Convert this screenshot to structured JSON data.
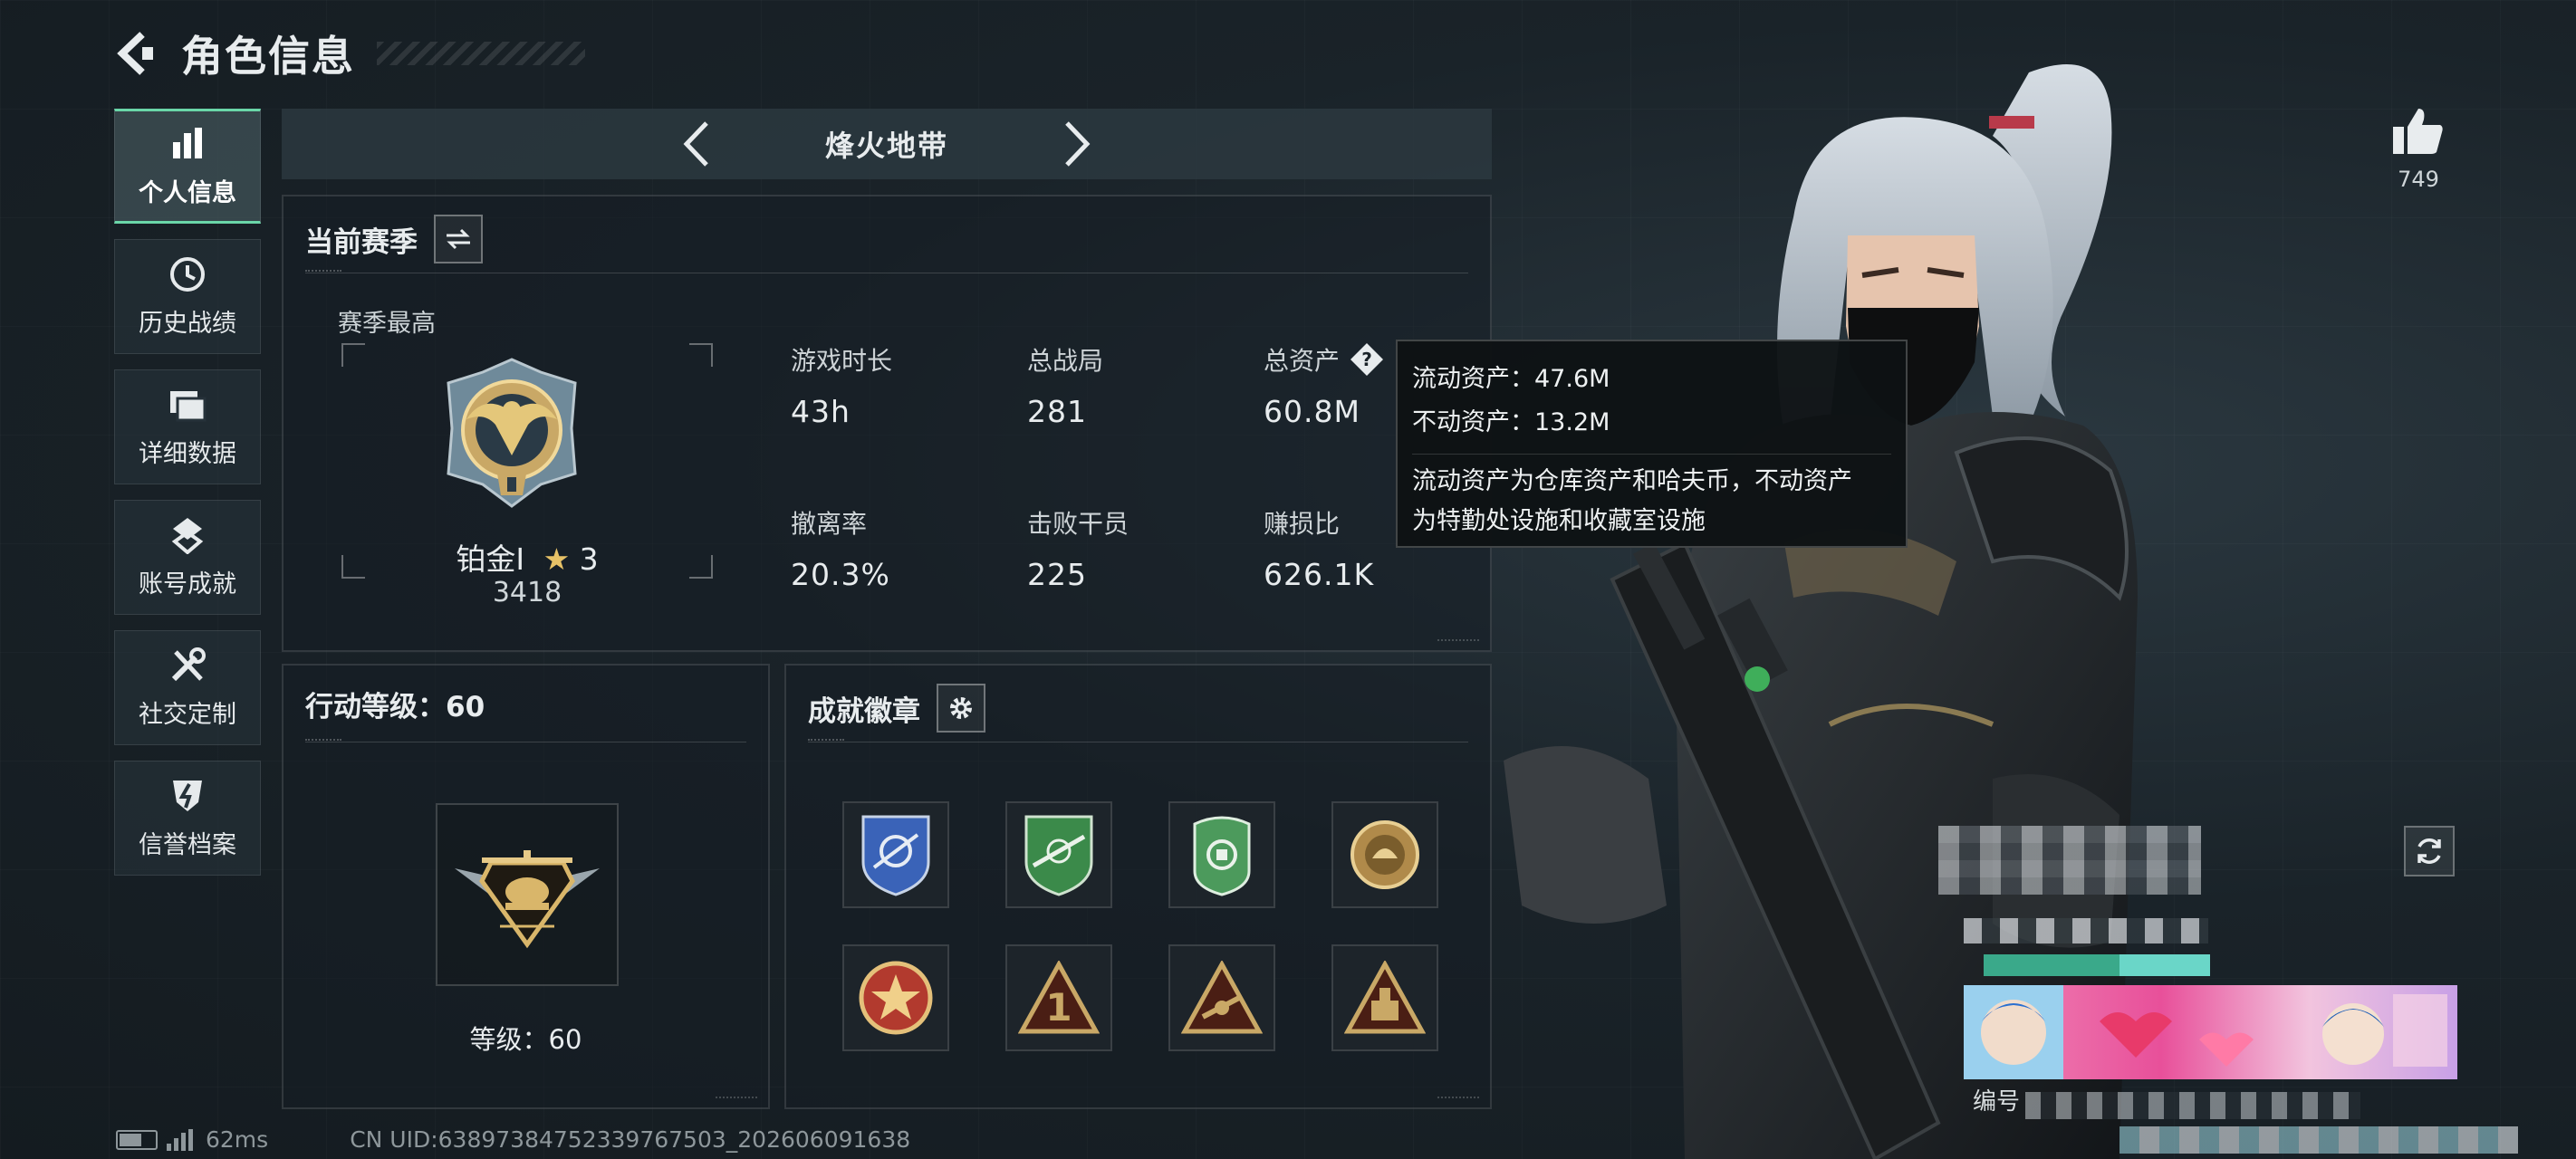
{
  "header": {
    "title": "角色信息"
  },
  "sidebar": {
    "items": [
      {
        "label": "个人信息",
        "icon": "bar-chart-icon",
        "active": true
      },
      {
        "label": "历史战绩",
        "icon": "history-icon"
      },
      {
        "label": "详细数据",
        "icon": "folder-icon"
      },
      {
        "label": "账号成就",
        "icon": "medal-icon"
      },
      {
        "label": "社交定制",
        "icon": "tools-icon"
      },
      {
        "label": "信誉档案",
        "icon": "shield-lightning-icon"
      }
    ]
  },
  "mode": {
    "name": "烽火地带"
  },
  "season": {
    "title": "当前赛季",
    "best_label": "赛季最高",
    "rank_name": "铂金Ⅰ",
    "rank_stars": "3",
    "rank_score": "3418",
    "stats": [
      {
        "label": "游戏时长",
        "value": "43h"
      },
      {
        "label": "总战局",
        "value": "281"
      },
      {
        "label": "总资产",
        "value": "60.8M",
        "has_help": true
      },
      {
        "label": "撤离率",
        "value": "20.3%"
      },
      {
        "label": "击败干员",
        "value": "225"
      },
      {
        "label": "赚损比",
        "value": "626.1K"
      }
    ]
  },
  "tooltip": {
    "liquid": "流动资产：47.6M",
    "fixed": "不动资产：13.2M",
    "desc_line1": "流动资产为仓库资产和哈夫币，不动资产",
    "desc_line2": "为特勤处设施和收藏室设施"
  },
  "level": {
    "title": "行动等级：60",
    "label": "等级：60"
  },
  "badges": {
    "title": "成就徽章",
    "items": [
      {
        "icon": "blue-shield-badge-icon",
        "color": "#3a63b8"
      },
      {
        "icon": "green-rifle-badge-icon",
        "color": "#3b8a4a"
      },
      {
        "icon": "green-crest-badge-icon",
        "color": "#4c9a5c"
      },
      {
        "icon": "bronze-coin-badge-icon",
        "color": "#b08a4a"
      },
      {
        "icon": "red-star-badge-icon",
        "color": "#b23a2e"
      },
      {
        "icon": "number-one-triangle-badge-icon",
        "color": "#c9a866"
      },
      {
        "icon": "rifle-triangle-badge-icon",
        "color": "#c9a866"
      },
      {
        "icon": "crate-triangle-badge-icon",
        "color": "#c9a866"
      }
    ]
  },
  "right": {
    "like_count": "749",
    "card_label": "编号"
  },
  "footer": {
    "ping": "62ms",
    "uid": "CN UID:6389738475233976750​3_202606091638"
  },
  "colors": {
    "accent": "#6ad6a8",
    "gold": "#c9a866"
  }
}
